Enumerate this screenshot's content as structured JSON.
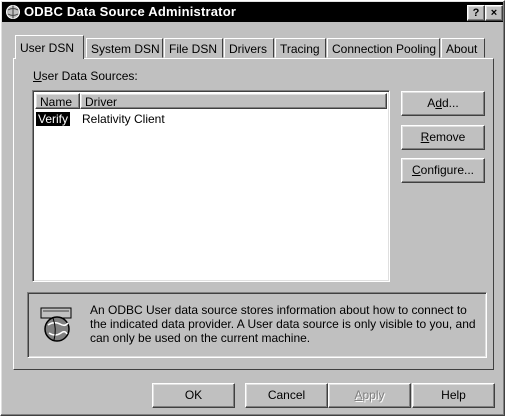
{
  "window": {
    "title": "ODBC Data Source Administrator",
    "help_glyph": "?",
    "close_glyph": "×"
  },
  "tabs": [
    {
      "label": "User DSN",
      "active": true
    },
    {
      "label": "System DSN"
    },
    {
      "label": "File DSN"
    },
    {
      "label": "Drivers"
    },
    {
      "label": "Tracing"
    },
    {
      "label": "Connection Pooling"
    },
    {
      "label": "About"
    }
  ],
  "user_dsn": {
    "group_label_mnemonic": "U",
    "group_label_rest": "ser Data Sources:",
    "columns": {
      "name": "Name",
      "driver": "Driver"
    },
    "rows": [
      {
        "name": "Verify",
        "driver": "Relativity Client",
        "selected": true
      }
    ],
    "buttons": {
      "add_pre": "A",
      "add_mn": "d",
      "add_post": "d...",
      "remove_mn": "R",
      "remove_post": "emove",
      "configure_mn": "C",
      "configure_post": "onfigure..."
    },
    "info_text": "An ODBC User data source stores information about how to connect to the indicated data provider.  A User data source is only visible to you, and can only be used on the current machine."
  },
  "footer": {
    "ok": "OK",
    "cancel": "Cancel",
    "apply_mn": "A",
    "apply_post": "pply",
    "help": "Help"
  },
  "icons": {
    "title_icon": "odbc-app-icon",
    "info_icon": "database-globe-icon"
  }
}
